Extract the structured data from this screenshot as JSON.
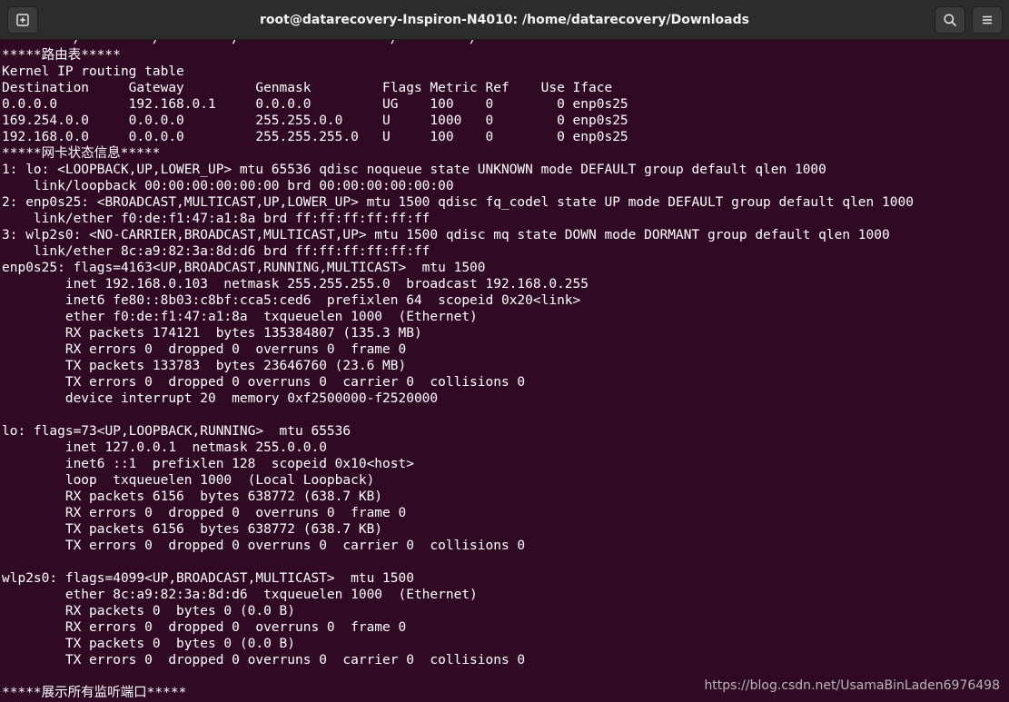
{
  "window": {
    "title": "root@datarecovery-Inspiron-N4010: /home/datarecovery/Downloads",
    "icons": {
      "new_tab": "new-tab-icon",
      "search": "search-icon",
      "menu": "hamburger-menu-icon"
    }
  },
  "colors": {
    "terminal_bg": "#300a24",
    "terminal_fg": "#ffffff",
    "titlebar_bg": "#2c2c2c"
  },
  "terminal": {
    "lines": [
      "         /         /         /                   /         /",
      "*****路由表*****",
      "Kernel IP routing table",
      "Destination     Gateway         Genmask         Flags Metric Ref    Use Iface",
      "0.0.0.0         192.168.0.1     0.0.0.0         UG    100    0        0 enp0s25",
      "169.254.0.0     0.0.0.0         255.255.0.0     U     1000   0        0 enp0s25",
      "192.168.0.0     0.0.0.0         255.255.255.0   U     100    0        0 enp0s25",
      "*****网卡状态信息*****",
      "1: lo: <LOOPBACK,UP,LOWER_UP> mtu 65536 qdisc noqueue state UNKNOWN mode DEFAULT group default qlen 1000",
      "    link/loopback 00:00:00:00:00:00 brd 00:00:00:00:00:00",
      "2: enp0s25: <BROADCAST,MULTICAST,UP,LOWER_UP> mtu 1500 qdisc fq_codel state UP mode DEFAULT group default qlen 1000",
      "    link/ether f0:de:f1:47:a1:8a brd ff:ff:ff:ff:ff:ff",
      "3: wlp2s0: <NO-CARRIER,BROADCAST,MULTICAST,UP> mtu 1500 qdisc mq state DOWN mode DORMANT group default qlen 1000",
      "    link/ether 8c:a9:82:3a:8d:d6 brd ff:ff:ff:ff:ff:ff",
      "enp0s25: flags=4163<UP,BROADCAST,RUNNING,MULTICAST>  mtu 1500",
      "        inet 192.168.0.103  netmask 255.255.255.0  broadcast 192.168.0.255",
      "        inet6 fe80::8b03:c8bf:cca5:ced6  prefixlen 64  scopeid 0x20<link>",
      "        ether f0:de:f1:47:a1:8a  txqueuelen 1000  (Ethernet)",
      "        RX packets 174121  bytes 135384807 (135.3 MB)",
      "        RX errors 0  dropped 0  overruns 0  frame 0",
      "        TX packets 133783  bytes 23646760 (23.6 MB)",
      "        TX errors 0  dropped 0 overruns 0  carrier 0  collisions 0",
      "        device interrupt 20  memory 0xf2500000-f2520000",
      "",
      "lo: flags=73<UP,LOOPBACK,RUNNING>  mtu 65536",
      "        inet 127.0.0.1  netmask 255.0.0.0",
      "        inet6 ::1  prefixlen 128  scopeid 0x10<host>",
      "        loop  txqueuelen 1000  (Local Loopback)",
      "        RX packets 6156  bytes 638772 (638.7 KB)",
      "        RX errors 0  dropped 0  overruns 0  frame 0",
      "        TX packets 6156  bytes 638772 (638.7 KB)",
      "        TX errors 0  dropped 0 overruns 0  carrier 0  collisions 0",
      "",
      "wlp2s0: flags=4099<UP,BROADCAST,MULTICAST>  mtu 1500",
      "        ether 8c:a9:82:3a:8d:d6  txqueuelen 1000  (Ethernet)",
      "        RX packets 0  bytes 0 (0.0 B)",
      "        RX errors 0  dropped 0  overruns 0  frame 0",
      "        TX packets 0  bytes 0 (0.0 B)",
      "        TX errors 0  dropped 0 overruns 0  carrier 0  collisions 0",
      "",
      "*****展示所有监听端口*****"
    ]
  },
  "watermark": {
    "text": "https://blog.csdn.net/UsamaBinLaden6976498"
  }
}
